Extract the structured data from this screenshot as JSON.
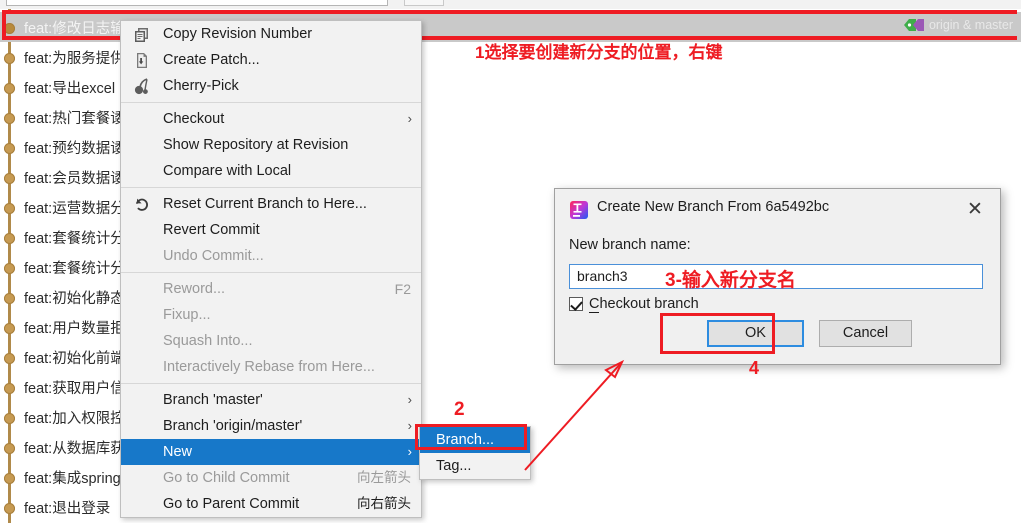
{
  "app": {
    "window_kind": "git-log-context-menu"
  },
  "log": {
    "selected_commit": {
      "subject": "feat:修改日志输出位置",
      "refs": [
        "origin & master"
      ],
      "ref_icon": "tag-icon"
    },
    "commits": [
      {
        "subject": "feat:为服务提供"
      },
      {
        "subject": "feat:导出excel"
      },
      {
        "subject": "feat:热门套餐诿"
      },
      {
        "subject": "feat:预约数据诿"
      },
      {
        "subject": "feat:会员数据诿"
      },
      {
        "subject": "feat:运营数据分"
      },
      {
        "subject": "feat:套餐统计分"
      },
      {
        "subject": "feat:套餐统计分"
      },
      {
        "subject": "feat:初始化静态"
      },
      {
        "subject": "feat:用户数量拒"
      },
      {
        "subject": "feat:初始化前端"
      },
      {
        "subject": "feat:获取用户信"
      },
      {
        "subject": "feat:加入权限控"
      },
      {
        "subject": "feat:从数据库获"
      },
      {
        "subject": "feat:集成spring"
      },
      {
        "subject": "feat:退出登录"
      }
    ]
  },
  "context_menu": {
    "items": [
      {
        "label": "Copy Revision Number",
        "icon": "copy-icon",
        "disabled": false,
        "submenu": false,
        "accel": ""
      },
      {
        "label": "Create Patch...",
        "icon": "patch-icon",
        "disabled": false,
        "submenu": false,
        "accel": ""
      },
      {
        "label": "Cherry-Pick",
        "icon": "cherry-pick-icon",
        "disabled": false,
        "submenu": false,
        "accel": ""
      },
      {
        "separator": true
      },
      {
        "label": "Checkout",
        "icon": "",
        "disabled": false,
        "submenu": true,
        "accel": ""
      },
      {
        "label": "Show Repository at Revision",
        "icon": "",
        "disabled": false,
        "submenu": false,
        "accel": ""
      },
      {
        "label": "Compare with Local",
        "icon": "",
        "disabled": false,
        "submenu": false,
        "accel": ""
      },
      {
        "separator": true
      },
      {
        "label": "Reset Current Branch to Here...",
        "icon": "reset-icon",
        "disabled": false,
        "submenu": false,
        "accel": ""
      },
      {
        "label": "Revert Commit",
        "icon": "",
        "disabled": false,
        "submenu": false,
        "accel": ""
      },
      {
        "label": "Undo Commit...",
        "icon": "",
        "disabled": true,
        "submenu": false,
        "accel": ""
      },
      {
        "separator": true
      },
      {
        "label": "Reword...",
        "icon": "",
        "disabled": true,
        "submenu": false,
        "accel": "F2"
      },
      {
        "label": "Fixup...",
        "icon": "",
        "disabled": true,
        "submenu": false,
        "accel": ""
      },
      {
        "label": "Squash Into...",
        "icon": "",
        "disabled": true,
        "submenu": false,
        "accel": ""
      },
      {
        "label": "Interactively Rebase from Here...",
        "icon": "",
        "disabled": true,
        "submenu": false,
        "accel": ""
      },
      {
        "separator": true
      },
      {
        "label": "Branch 'master'",
        "icon": "",
        "disabled": false,
        "submenu": true,
        "accel": ""
      },
      {
        "label": "Branch 'origin/master'",
        "icon": "",
        "disabled": false,
        "submenu": true,
        "accel": ""
      },
      {
        "label": "New",
        "icon": "",
        "disabled": false,
        "submenu": true,
        "accel": "",
        "highlight": true
      },
      {
        "label": "Go to Child Commit",
        "icon": "",
        "disabled": true,
        "submenu": false,
        "accel": "向左箭头",
        "accel_cjk": true
      },
      {
        "label": "Go to Parent Commit",
        "icon": "",
        "disabled": false,
        "submenu": false,
        "accel": "向右箭头",
        "accel_cjk": true
      }
    ]
  },
  "sub_menu": {
    "items": [
      {
        "label": "Branch...",
        "highlight": true
      },
      {
        "label": "Tag...",
        "highlight": false
      }
    ]
  },
  "dialog": {
    "title": "Create New Branch From 6a5492bc",
    "icon": "intellij-idea-icon",
    "close_label": "✕",
    "field_label": "New branch name:",
    "branch_name_value": "branch3",
    "branch_name_placeholder": "",
    "checkbox_label_prefix": "C",
    "checkbox_label_rest": "heckout branch",
    "checkbox_checked": true,
    "ok_label": "OK",
    "cancel_label": "Cancel"
  },
  "annotations": {
    "step1": "1选择要创建新分支的位置，右键",
    "step2": "2",
    "step3": "3-输入新分支名",
    "step4": "4",
    "accent_color": "#ee1c23"
  }
}
